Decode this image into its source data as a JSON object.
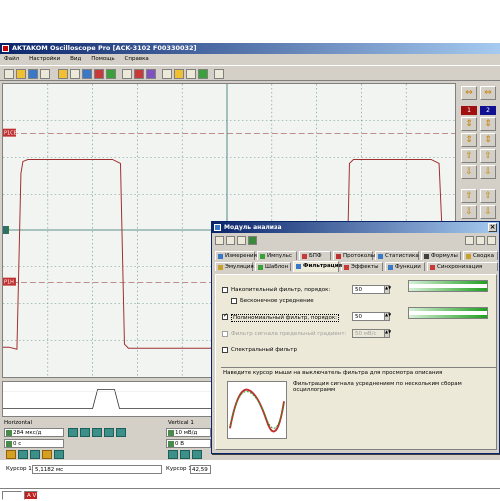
{
  "window": {
    "title": "AKTAKOM Oscilloscope Pro [ACK-3102 F00330032]",
    "menu": [
      "Файл",
      "Настройки",
      "Вид",
      "Помощь",
      "Справка"
    ]
  },
  "scope": {
    "markers": {
      "ch1_top": "P1CB",
      "ch_mid": "C",
      "ch1_bottom": "P1H"
    },
    "colors": {
      "trace": "#a03030",
      "grid": "#5e8f8a",
      "background": "#f1f4f1"
    }
  },
  "right_panel": {
    "channel1": "1",
    "channel2": "2"
  },
  "horizontal": {
    "label": "Horizontal",
    "timebase": "284 мкс/д",
    "offset": "0 с",
    "cursor_label": "Курсор 1",
    "cursor_value": "5,1182 мс"
  },
  "vertical": {
    "label": "Vertical 1",
    "scale": "10 мВ/д",
    "offset": "0 В",
    "cursor_label": "Курсор 1",
    "cursor_value": "42,59"
  },
  "statusbar": {
    "indicator": "A V"
  },
  "dialog": {
    "title": "Модуль анализа",
    "tabs_row1": [
      "Измерения",
      "Импульс",
      "БПФ",
      "Протоколы",
      "Статистика",
      "Формулы",
      "Сводка"
    ],
    "tabs_row2": [
      "Эмуляция",
      "Шаблон",
      "Фильтрация",
      "Эффекты",
      "Функции",
      "Синхронизация"
    ],
    "active_tab": "Фильтрация",
    "options": {
      "accumulation_label": "Накопительный фильтр, порядок:",
      "accumulation_value": "50",
      "accumulation_checked": false,
      "infinite_label": "Бесконечное усреднение",
      "infinite_checked": false,
      "polynomial_label": "Полиномиальный фильтр, порядок:",
      "polynomial_value": "50",
      "polynomial_checked": true,
      "gradient_label": "Фильтр сигнала предельный градиент:",
      "gradient_value": "50 мВ/с",
      "gradient_checked": false,
      "spectral_label": "Спектральный фильтр",
      "spectral_checked": false
    },
    "hint": "Наведите курсор мыши на выключатель фильтра для просмотра описания",
    "description": "Фильтрация сигнала усреднением по нескольким сборам осциллограмм"
  }
}
